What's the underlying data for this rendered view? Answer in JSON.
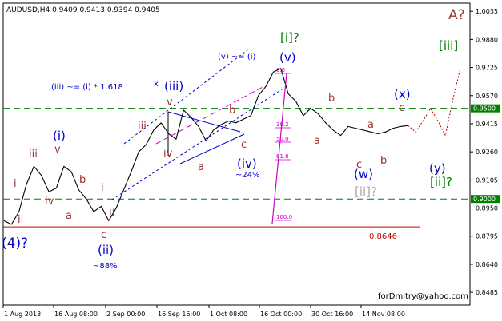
{
  "chart_data": {
    "type": "line",
    "title": "AUDUSD,H4  0.9409 0.9413 0.9394 0.9405",
    "symbol": "AUDUSD",
    "timeframe": "H4",
    "ohlc": {
      "open": 0.9409,
      "high": 0.9413,
      "low": 0.9394,
      "close": 0.9405
    },
    "xlabel": "",
    "ylabel": "",
    "ylim": [
      0.8415,
      1.008
    ],
    "grid": false,
    "x_ticks": [
      "1 Aug 2013",
      "16 Aug 08:00",
      "2 Sep 00:00",
      "16 Sep 16:00",
      "1 Oct 08:00",
      "16 Oct 00:00",
      "30 Oct 16:00",
      "14 Nov 08:00"
    ],
    "y_ticks": [
      "1.0035",
      "0.9880",
      "0.9725",
      "0.9570",
      "0.9415",
      "0.9260",
      "0.9105",
      "0.8950",
      "0.8795",
      "0.8640",
      "0.8485"
    ],
    "levels": [
      {
        "value": 0.95,
        "label": "0.9500",
        "style": "dashed",
        "color": "#008000"
      },
      {
        "value": 0.9,
        "label": "0.9000",
        "style": "dashed",
        "color": "#008000"
      },
      {
        "value": 0.8846,
        "label": "0.8646",
        "style": "solid",
        "color": "#cc0000"
      }
    ],
    "series": [
      {
        "x": [
          0,
          2,
          4,
          6,
          8,
          10,
          12,
          14,
          16,
          18,
          20,
          22,
          24,
          26,
          28,
          30,
          32,
          34,
          36,
          38,
          40,
          42,
          44,
          46,
          48,
          50,
          52,
          54,
          56,
          58,
          60,
          62,
          64,
          66,
          68,
          70,
          72,
          74,
          76,
          78,
          80,
          82,
          84,
          86,
          88,
          90,
          92,
          94,
          96,
          98,
          100,
          102,
          104,
          106,
          108
        ],
        "values": [
          0.888,
          0.886,
          0.893,
          0.908,
          0.918,
          0.913,
          0.904,
          0.906,
          0.918,
          0.915,
          0.905,
          0.9,
          0.893,
          0.896,
          0.888,
          0.895,
          0.905,
          0.915,
          0.926,
          0.93,
          0.938,
          0.942,
          0.936,
          0.933,
          0.949,
          0.945,
          0.94,
          0.932,
          0.938,
          0.941,
          0.943,
          0.942,
          0.944,
          0.946,
          0.957,
          0.962,
          0.97,
          0.972,
          0.958,
          0.954,
          0.946,
          0.95,
          0.947,
          0.942,
          0.938,
          0.935,
          0.94,
          0.939,
          0.938,
          0.937,
          0.936,
          0.937,
          0.939,
          0.94,
          0.9405
        ]
      }
    ],
    "projection": {
      "style": "dotted",
      "color": "#cc0000",
      "x": [
        108,
        110,
        112,
        114,
        116,
        118,
        120,
        122
      ],
      "values": [
        0.9405,
        0.937,
        0.943,
        0.95,
        0.943,
        0.935,
        0.955,
        0.972
      ]
    },
    "annotations": [
      {
        "text": "A?",
        "color": "#993333",
        "size": "big"
      },
      {
        "text": "[iii]",
        "color": "#008000",
        "size": "mid"
      },
      {
        "text": "[i]?",
        "color": "#008000",
        "size": "mid"
      },
      {
        "text": "(v)",
        "color": "#0000cc",
        "size": "mid"
      },
      {
        "text": "(v) ~= (i)",
        "color": "#0000cc",
        "size": "note"
      },
      {
        "text": "(iii) ~= (i) * 1.618",
        "color": "#0000cc",
        "size": "note"
      },
      {
        "text": "x",
        "color": "#0000cc",
        "size": "note"
      },
      {
        "text": "(iii)",
        "color": "#0000cc",
        "size": "mid"
      },
      {
        "text": "v",
        "color": "#993333",
        "size": "sm"
      },
      {
        "text": "iii",
        "color": "#993333",
        "size": "sm"
      },
      {
        "text": "iv",
        "color": "#993333",
        "size": "sm"
      },
      {
        "text": "b",
        "color": "#993333",
        "size": "sm"
      },
      {
        "text": "a",
        "color": "#993333",
        "size": "sm"
      },
      {
        "text": "c",
        "color": "#993333",
        "size": "sm"
      },
      {
        "text": "(iv)",
        "color": "#0000cc",
        "size": "mid"
      },
      {
        "text": "~24%",
        "color": "#0000cc",
        "size": "note"
      },
      {
        "text": "(i)",
        "color": "#0000cc",
        "size": "mid"
      },
      {
        "text": "v",
        "color": "#993333",
        "size": "sm"
      },
      {
        "text": "iii",
        "color": "#993333",
        "size": "sm"
      },
      {
        "text": "iv",
        "color": "#993333",
        "size": "sm"
      },
      {
        "text": "i",
        "color": "#993333",
        "size": "sm"
      },
      {
        "text": "ii",
        "color": "#993333",
        "size": "sm"
      },
      {
        "text": "b",
        "color": "#993333",
        "size": "sm"
      },
      {
        "text": "a",
        "color": "#993333",
        "size": "sm"
      },
      {
        "text": "i",
        "color": "#993333",
        "size": "sm"
      },
      {
        "text": "ii",
        "color": "#993333",
        "size": "sm"
      },
      {
        "text": "c",
        "color": "#993333",
        "size": "sm"
      },
      {
        "text": "(ii)",
        "color": "#0000cc",
        "size": "mid"
      },
      {
        "text": "~88%",
        "color": "#0000cc",
        "size": "note"
      },
      {
        "text": "(4)?",
        "color": "#0000cc",
        "size": "big"
      },
      {
        "text": "b",
        "color": "#993333",
        "size": "sm"
      },
      {
        "text": "a",
        "color": "#993333",
        "size": "sm"
      },
      {
        "text": "c",
        "color": "#993333",
        "size": "sm"
      },
      {
        "text": "(w)",
        "color": "#0000cc",
        "size": "mid"
      },
      {
        "text": "[ii]?",
        "color": "#aaaaaa",
        "size": "mid"
      },
      {
        "text": "a",
        "color": "#993333",
        "size": "sm"
      },
      {
        "text": "b",
        "color": "#993333",
        "size": "sm"
      },
      {
        "text": "(x)",
        "color": "#0000cc",
        "size": "mid"
      },
      {
        "text": "c",
        "color": "#993333",
        "size": "sm"
      },
      {
        "text": "(y)",
        "color": "#0000cc",
        "size": "mid"
      },
      {
        "text": "[ii]?",
        "color": "#008000",
        "size": "mid"
      },
      {
        "text": "0.8646",
        "color": "#cc0000",
        "size": "note"
      },
      {
        "text": "forDmitry@yahoo.com",
        "color": "#000000",
        "size": "note"
      }
    ],
    "fibonacci": [
      "0.0",
      "38.2",
      "50.0",
      "61.8",
      "100.0"
    ],
    "colors": {
      "price": "#000000",
      "blue_wave": "#0000cc",
      "red_wave": "#993333",
      "green_wave": "#008000",
      "fib": "#cc00cc"
    }
  }
}
